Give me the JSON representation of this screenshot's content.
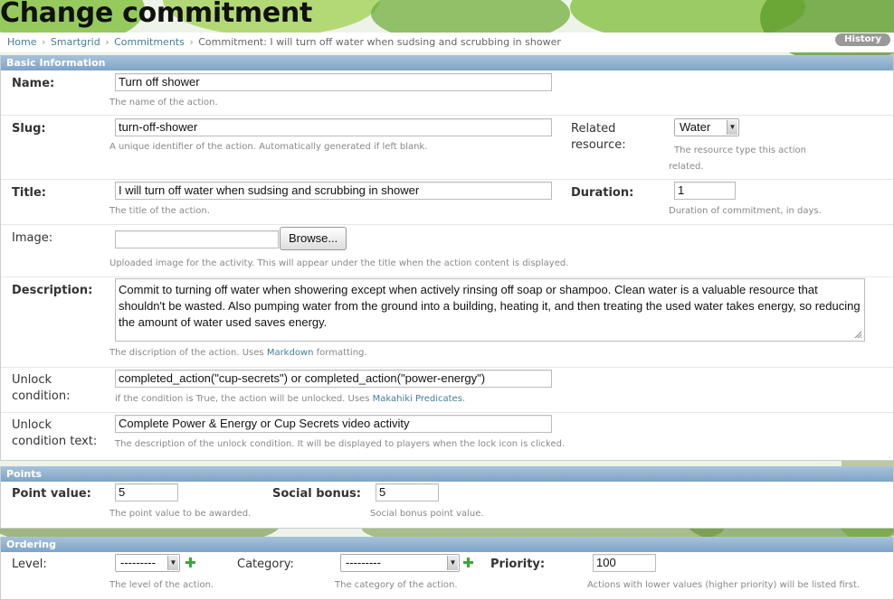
{
  "page_title": "Change commitment",
  "breadcrumbs": [
    "Home",
    "Smartgrid",
    "Commitments",
    "Commitment: I will turn off water when sudsing and scrubbing in shower"
  ],
  "history_button": "History",
  "sections": {
    "basic": "Basic Information",
    "points": "Points",
    "ordering": "Ordering"
  },
  "fields": {
    "name": {
      "label": "Name:",
      "value": "Turn off shower",
      "help": "The name of the action."
    },
    "slug": {
      "label": "Slug:",
      "value": "turn-off-shower",
      "help": "A unique identifier of the action. Automatically generated if left blank."
    },
    "related_resource": {
      "label_1": "Related",
      "label_2": "resource:",
      "value": "Water",
      "help_1": "The resource type this action",
      "help_2": "related."
    },
    "title": {
      "label": "Title:",
      "value": "I will turn off water when sudsing and scrubbing in shower",
      "help": "The title of the action."
    },
    "duration": {
      "label": "Duration:",
      "value": "1",
      "help": "Duration of commitment, in days."
    },
    "image": {
      "label": "Image:",
      "browse": "Browse...",
      "help": "Uploaded image for the activity. This will appear under the title when the action content is displayed."
    },
    "description": {
      "label": "Description:",
      "value": "Commit to turning off water when showering except when actively rinsing off soap or shampoo. Clean water is a valuable resource that shouldn't be wasted. Also pumping water from the ground into a building, heating it, and then treating the used water takes energy, so reducing the amount of water used saves energy.",
      "help_pre": "The discription of the action. Uses ",
      "help_link": "Markdown",
      "help_post": " formatting."
    },
    "unlock_condition": {
      "label_1": "Unlock",
      "label_2": "condition:",
      "value": "completed_action(\"cup-secrets\") or completed_action(\"power-energy\")",
      "help_pre": "if the condition is True, the action will be unlocked. Uses ",
      "help_link": "Makahiki Predicates",
      "help_post": "."
    },
    "unlock_condition_text": {
      "label_1": "Unlock",
      "label_2": "condition text:",
      "value": "Complete Power & Energy or Cup Secrets video activity",
      "help": "The description of the unlock condition. It will be displayed to players when the lock icon is clicked."
    },
    "point_value": {
      "label": "Point value:",
      "value": "5",
      "help": "The point value to be awarded."
    },
    "social_bonus": {
      "label": "Social bonus:",
      "value": "5",
      "help": "Social bonus point value."
    },
    "level": {
      "label": "Level:",
      "value": "---------",
      "help": "The level of the action."
    },
    "category": {
      "label": "Category:",
      "value": "---------",
      "help": "The category of the action."
    },
    "priority": {
      "label": "Priority:",
      "value": "100",
      "help": "Actions with lower values (higher priority) will be listed first."
    }
  },
  "colors": {
    "module_header": "#7ea4c7",
    "link": "#447e9b",
    "add_icon": "#3aa63a"
  }
}
